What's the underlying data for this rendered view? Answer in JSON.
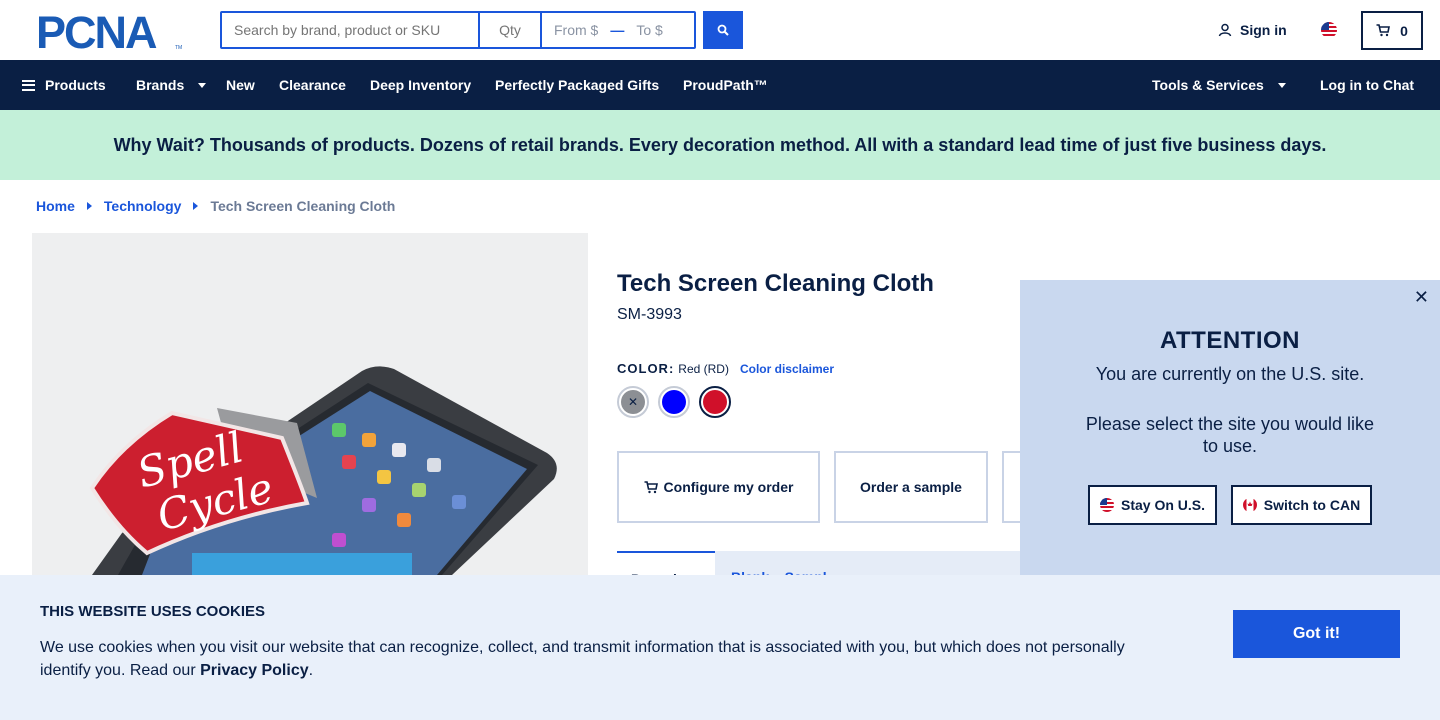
{
  "header": {
    "logo_text": "PCNA",
    "search": {
      "placeholder": "Search by brand, product or SKU",
      "qty_placeholder": "Qty",
      "price_from": "From $",
      "price_to": "To $"
    },
    "sign_in": "Sign in",
    "cart_count": "0"
  },
  "nav": {
    "products": "Products",
    "brands": "Brands",
    "new": "New",
    "clearance": "Clearance",
    "deep_inventory": "Deep Inventory",
    "gifts": "Perfectly Packaged Gifts",
    "proudpath": "ProudPath™",
    "tools": "Tools & Services",
    "chat": "Log in to Chat"
  },
  "promo": "Why Wait? Thousands of products. Dozens of retail brands. Every decoration method. All with a standard lead time of just five business days.",
  "breadcrumb": {
    "home": "Home",
    "category": "Technology",
    "current": "Tech Screen Cleaning Cloth"
  },
  "product": {
    "image_text": "Spell Cycle",
    "title": "Tech Screen Cleaning Cloth",
    "sku": "SM-3993",
    "color_label": "COLOR:",
    "color_value": "Red (RD)",
    "color_disclaimer": "Color disclaimer",
    "swatches": [
      {
        "name": "Gray",
        "color": "#8c8f94",
        "unavailable": true
      },
      {
        "name": "Blue",
        "color": "#0000ff"
      },
      {
        "name": "Red",
        "color": "#d0102a",
        "selected": true
      }
    ],
    "actions": {
      "configure": "Configure my order",
      "sample": "Order a sample"
    },
    "tabs": {
      "active": "Pers...l",
      "second": "Blank... Sampl..."
    }
  },
  "attention": {
    "title": "ATTENTION",
    "message1": "You are currently on the U.S. site.",
    "message2": "Please select the site you would like to use.",
    "stay": "Stay On U.S.",
    "switch": "Switch to CAN"
  },
  "cookie": {
    "title": "THIS WEBSITE USES COOKIES",
    "text": "We use cookies when you visit our website that can recognize, collect, and transmit information that is associated with you, but which does not personally identify you. Read our ",
    "link": "Privacy Policy",
    "end": ".",
    "button": "Got it!"
  },
  "colors": {
    "navy": "#0a1f44",
    "blue": "#1a56db",
    "promo_bg": "#c3f0d9",
    "attention_bg": "#c9d8ef",
    "cookie_bg": "#e9f0fa"
  }
}
